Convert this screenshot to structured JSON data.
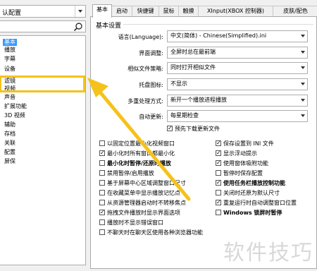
{
  "left_panel": {
    "profile_select": "认配置",
    "tree_items": [
      "基本",
      "播放",
      "字幕",
      "设备",
      "滤镜",
      "视频",
      "声音",
      "扩展功能",
      "3D 视频",
      "辅助",
      "存档",
      "关联",
      "配置",
      "屏保"
    ]
  },
  "tabs": [
    "基本",
    "启动",
    "快捷键",
    "鼠标",
    "触摸",
    "XInput(XBOX 控制器)",
    "皮肤/配色"
  ],
  "group": {
    "title": "基本设置",
    "rows": [
      {
        "label": "语言(Language):",
        "value": "中文(简体) - Chinese(Simplified).ini"
      },
      {
        "label": "界面调整:",
        "value": "全屏时总在最前端"
      },
      {
        "label": "相似文件策略:",
        "value": "同时打开相似文件"
      },
      {
        "label": "托盘图标:",
        "value": "不显示"
      },
      {
        "label": "多重处理方式:",
        "value": "新开一个播放进程播放"
      },
      {
        "label": "自动更新:",
        "value": "每星期检查"
      }
    ],
    "predownload": "预先下载更新文件"
  },
  "checkboxes_left": [
    {
      "label": "以固定位置最小化视频窗口",
      "checked": false,
      "bold": false
    },
    {
      "label": "最小化时所有窗口都最小化",
      "checked": true,
      "bold": false
    },
    {
      "label": "最小化时暂停/还原时播放",
      "checked": false,
      "bold": true
    },
    {
      "label": "禁用暂停/启用播放",
      "checked": false,
      "bold": false
    },
    {
      "label": "基于屏幕中心区域调整窗口尺寸",
      "checked": false,
      "bold": false
    },
    {
      "label": "在收藏菜单中显示播放记忆点",
      "checked": false,
      "bold": false
    },
    {
      "label": "从资源管理器启动时不转移焦点",
      "checked": false,
      "bold": false
    },
    {
      "label": "拖拽文件播放时显示界面选项",
      "checked": true,
      "bold": false
    },
    {
      "label": "播放时不显示错误窗口",
      "checked": false,
      "bold": false
    },
    {
      "label": "不聊天时在聊天区使用各种浏览器功能",
      "checked": false,
      "bold": false
    }
  ],
  "checkboxes_right": [
    {
      "label": "保存设置到 INI 文件",
      "checked": true,
      "bold": false
    },
    {
      "label": "显示浮动提示",
      "checked": true,
      "bold": false
    },
    {
      "label": "使用窗体吸附功能",
      "checked": true,
      "bold": false
    },
    {
      "label": "暂停时保存配置",
      "checked": false,
      "bold": false
    },
    {
      "label": "使用任务栏播放控制功能",
      "checked": true,
      "bold": true
    },
    {
      "label": "关闭时还原为默认尺寸",
      "checked": false,
      "bold": false
    },
    {
      "label": "重复运行时自动调整窗口位置",
      "checked": true,
      "bold": false
    },
    {
      "label": "Windows 锁屏时暂停",
      "checked": false,
      "bold": true
    }
  ],
  "watermark": "软件技巧",
  "colors": {
    "selection": "#3399ff",
    "highlight": "#f5c21b"
  }
}
